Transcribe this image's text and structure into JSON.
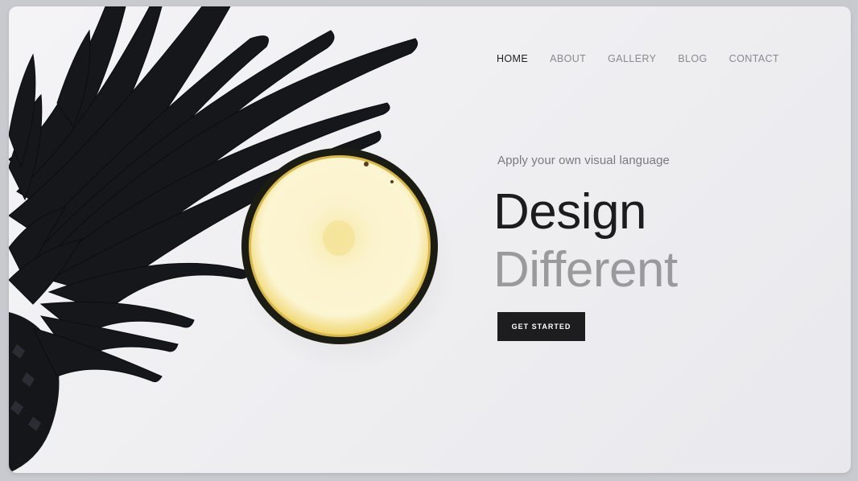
{
  "nav": {
    "items": [
      {
        "label": "HOME"
      },
      {
        "label": "ABOUT"
      },
      {
        "label": "GALLERY"
      },
      {
        "label": "BLOG"
      },
      {
        "label": "CONTACT"
      }
    ],
    "active": "HOME"
  },
  "hero": {
    "tagline": "Apply your own visual language",
    "headline_line1": "Design",
    "headline_line2": "Different",
    "cta_label": "GET STARTED",
    "image": "black-pineapple-with-slice"
  },
  "colors": {
    "background": "#f0f0f2",
    "text_dark": "#1c1c1e",
    "text_muted": "#9a9a9c",
    "button_bg": "#1d1d1f",
    "pineapple_leaves": "#15171a",
    "pineapple_flesh": "#fbf3c7"
  }
}
